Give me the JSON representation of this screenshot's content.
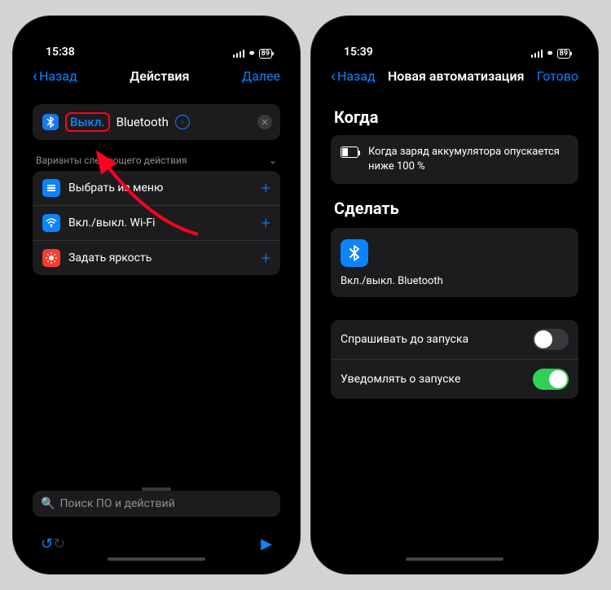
{
  "left": {
    "status": {
      "time": "15:38",
      "battery": "89"
    },
    "nav": {
      "back": "Назад",
      "title": "Действия",
      "next": "Далее"
    },
    "action": {
      "toggle_value": "Выкл.",
      "name": "Bluetooth"
    },
    "suggestions_header": "Варианты следующего действия",
    "suggestions": [
      {
        "label": "Выбрать из меню"
      },
      {
        "label": "Вкл./выкл. Wi-Fi"
      },
      {
        "label": "Задать яркость"
      }
    ],
    "search_placeholder": "Поиск ПО и действий"
  },
  "right": {
    "status": {
      "time": "15:39",
      "battery": "89"
    },
    "nav": {
      "back": "Назад",
      "title": "Новая автоматизация",
      "done": "Готово"
    },
    "when_title": "Когда",
    "condition": "Когда заряд аккумулятора опускается ниже 100 %",
    "do_title": "Сделать",
    "action_label": "Вкл./выкл. Bluetooth",
    "toggles": {
      "ask_label": "Спрашивать до запуска",
      "ask_on": false,
      "notify_label": "Уведомлять о запуске",
      "notify_on": true
    }
  },
  "colors": {
    "accent": "#0a84ff",
    "highlight": "#ff0020",
    "green": "#30d158"
  }
}
